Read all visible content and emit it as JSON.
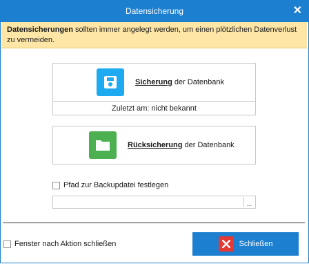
{
  "window": {
    "title": "Datensicherung",
    "close_glyph": "✕"
  },
  "banner": {
    "bold": "Datensicherungen",
    "text": " sollten immer angelegt werden, um einen plötzlichen Datenverlust zu vermeiden."
  },
  "backup": {
    "label_bold": "Sicherung",
    "label_rest": " der Datenbank",
    "status": "Zuletzt am: nicht bekannt",
    "icon": "floppy-disk-icon",
    "color": "#1eaaf1"
  },
  "restore": {
    "label_bold": "Rücksicherung",
    "label_rest": " der Datenbank",
    "icon": "folder-icon",
    "color": "#4caf50"
  },
  "backup_path": {
    "checkbox_label": "Pfad zur Backupdatei festlegen",
    "value": "",
    "browse_label": "..."
  },
  "footer": {
    "close_after_label": "Fenster nach Aktion schließen",
    "close_button_label": "Schließen"
  },
  "colors": {
    "accent": "#1c7fd0",
    "banner": "#fde6a6",
    "close_icon_bg": "#e53935"
  }
}
